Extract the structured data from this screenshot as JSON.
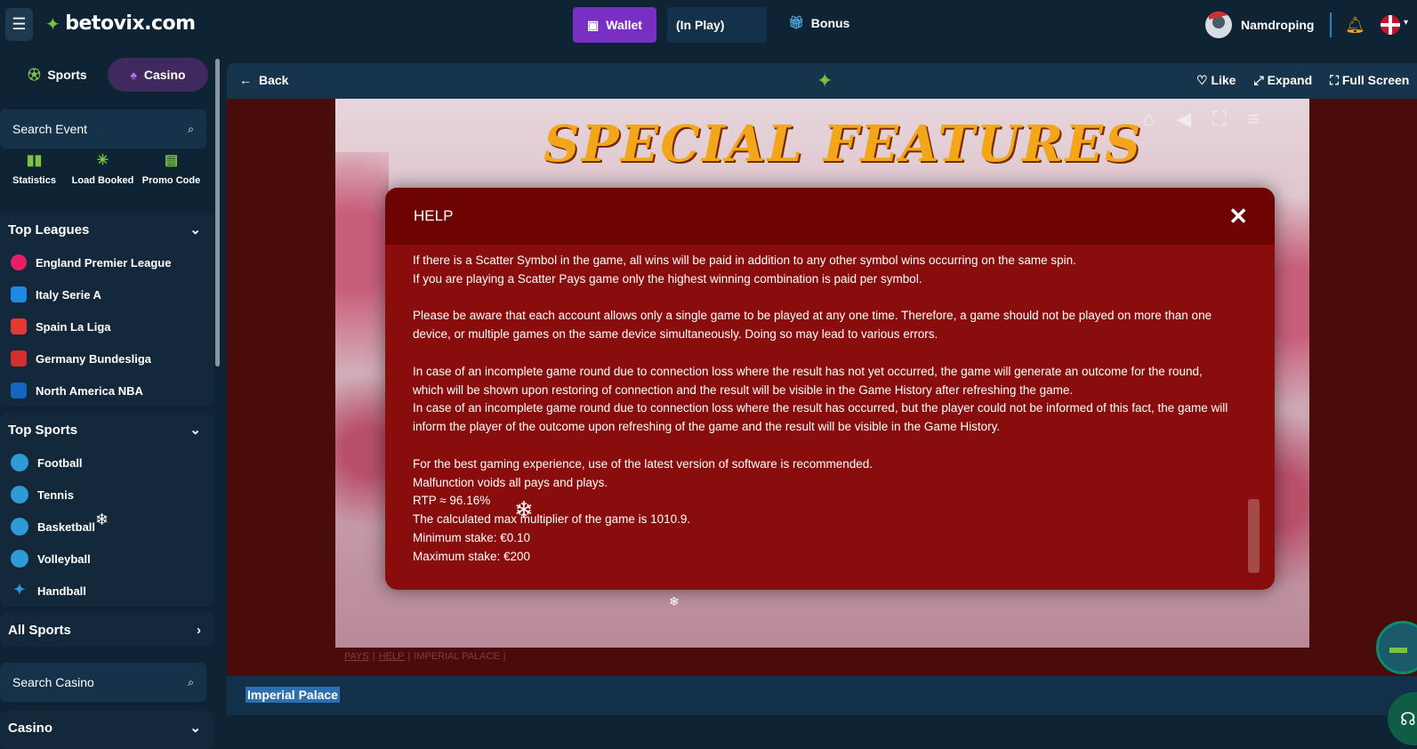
{
  "header": {
    "menu_icon": "hamburger-icon",
    "brand": "betovix.com",
    "wallet_label": "Wallet",
    "inplay_label": "(In Play)",
    "bonus_label": "Bonus",
    "username": "Namdroping",
    "language": "English (UK)"
  },
  "sidebar": {
    "tabs": [
      {
        "label": "Sports",
        "icon": "soccer-ball-icon"
      },
      {
        "label": "Casino",
        "icon": "spade-icon"
      }
    ],
    "search_event_placeholder": "Search Event",
    "quick_links": [
      {
        "label": "Statistics",
        "icon": "bar-chart-icon"
      },
      {
        "label": "Load Booked",
        "icon": "loader-icon"
      },
      {
        "label": "Promo Code",
        "icon": "ticket-icon"
      }
    ],
    "top_leagues": {
      "title": "Top Leagues",
      "items": [
        {
          "label": "England Premier League",
          "color": "#e91e63"
        },
        {
          "label": "Italy Serie A",
          "color": "#1e88e5"
        },
        {
          "label": "Spain La Liga",
          "color": "#e53935"
        },
        {
          "label": "Germany Bundesliga",
          "color": "#d32f2f"
        },
        {
          "label": "North America NBA",
          "color": "#1565c0"
        }
      ]
    },
    "top_sports": {
      "title": "Top Sports",
      "items": [
        {
          "label": "Football"
        },
        {
          "label": "Tennis"
        },
        {
          "label": "Basketball"
        },
        {
          "label": "Volleyball"
        },
        {
          "label": "Handball"
        }
      ]
    },
    "all_sports": "All Sports",
    "search_casino_placeholder": "Search Casino",
    "casino_title": "Casino"
  },
  "gamebar": {
    "back_label": "Back",
    "like_label": "Like",
    "expand_label": "Expand",
    "fullscreen_label": "Full Screen"
  },
  "game": {
    "banner": "SPECIAL FEATURES",
    "tabs": [
      "PAYS",
      "HELP",
      "IMPERIAL PALACE"
    ],
    "title": "Imperial Palace"
  },
  "help_modal": {
    "title": "HELP",
    "paragraphs": [
      "If there is a Scatter Symbol in the game, all wins will be paid in addition to any other symbol wins occurring on the same spin.",
      "If you are playing a Scatter Pays game only the highest winning combination is paid per symbol.",
      "",
      "Please be aware that each account allows only a single game to be played at any one time. Therefore, a game should not be played on more than one device, or multiple games on the same device simultaneously. Doing so may lead to various errors.",
      "",
      "In case of an incomplete game round due to connection loss where the result has not yet occurred, the game will generate an outcome for the round, which will be shown upon restoring of connection and the result will be visible in the Game History after refreshing the game.",
      "In case of an incomplete game round due to connection loss where the result has occurred, but the player could not be informed of this fact, the game will inform the player of the outcome upon refreshing of the game and the result will be visible in the Game History.",
      "",
      "For the best gaming experience, use of the latest version of software is recommended.",
      "Malfunction voids all pays and plays.",
      "RTP ≈ 96.16%",
      "The calculated max multiplier of the game is 1010.9.",
      "Minimum stake: €0.10",
      "Maximum stake: €200"
    ]
  }
}
